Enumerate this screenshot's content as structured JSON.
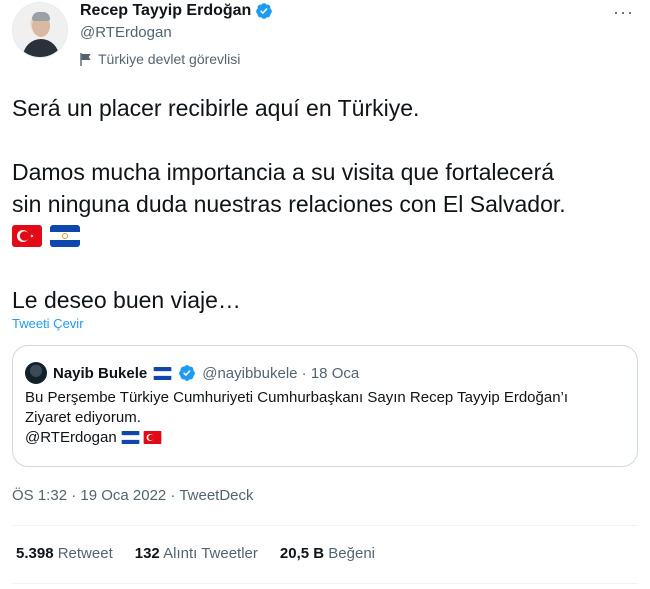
{
  "author": {
    "display_name": "Recep Tayyip Erdoğan",
    "handle": "@RTErdogan",
    "affiliation": "Türkiye devlet görevlisi"
  },
  "tweet": {
    "line1": "Será un placer recibirle aquí en Türkiye.",
    "line2": "Damos mucha importancia a su visita que fortalecerá",
    "line3": "sin ninguna duda nuestras relaciones con El Salvador.",
    "line4": "Le deseo buen viaje…",
    "flag_emojis": [
      "turkey-flag",
      "el-salvador-flag"
    ],
    "translate_label": "Tweeti Çevir"
  },
  "quoted_tweet": {
    "display_name": "Nayib Bukele",
    "handle_date": "@nayibbukele · 18 Oca",
    "line1": "Bu Perşembe Türkiye Cumhuriyeti Cumhurbaşkanı Sayın Recep Tayyip Erdoğan’ı",
    "line2": "Ziyaret ediyorum.",
    "line3": "@RTErdogan"
  },
  "meta": {
    "timestamp": "ÖS 1:32 · 19 Oca 2022 · TweetDeck"
  },
  "stats": {
    "retweets_count": "5.398",
    "retweets_label": "Retweet",
    "quotes_count": "132",
    "quotes_label": "Alıntı Tweetler",
    "likes_count": "20,5 B",
    "likes_label": "Beğeni"
  },
  "colors": {
    "accent": "#1d9bf0",
    "secondary_text": "#536471",
    "border": "#cfd9de"
  },
  "more_icon": "more-horizontal-icon"
}
